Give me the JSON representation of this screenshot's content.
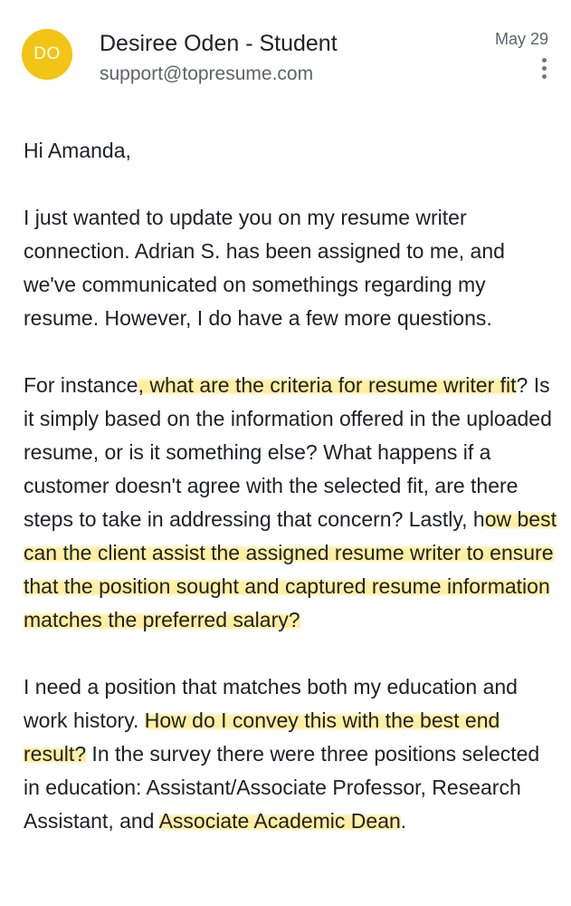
{
  "header": {
    "avatar_initials": "DO",
    "avatar_color": "#f2c413",
    "sender_name": "Desiree Oden - Student",
    "sender_email": "support@topresume.com",
    "date": "May 29",
    "more_icon": "more-vert-icon"
  },
  "email": {
    "greeting": "Hi Amanda,",
    "p1": "I just wanted to update you on my resume writer connection. Adrian S. has been assigned to me, and we've communicated on somethings regarding my resume. However, I do have a few more questions.",
    "p2_a": "For instance",
    "p2_h1": ", what are the criteria for resume writer fit",
    "p2_b": "? Is it simply based on the information offered in the uploaded resume, or is it something else? What happens if a customer doesn't agree with the selected fit, are there steps to take in addressing that concern? Lastly, h",
    "p2_h2": "ow best can the client assist the assigned resume writer to ensure that the position sought and captured resume information matches the preferred salary?",
    "p3_a": "I need a position that matches both my education and work history. ",
    "p3_h1": "How do I convey this with the best end result?",
    "p3_b": " In the survey there were three positions selected in education: Assistant/Associate Professor, Research Assistant, and ",
    "p3_h2": "Associate Academic Dean",
    "p3_c": "."
  },
  "highlight_color": "#ffe14a"
}
